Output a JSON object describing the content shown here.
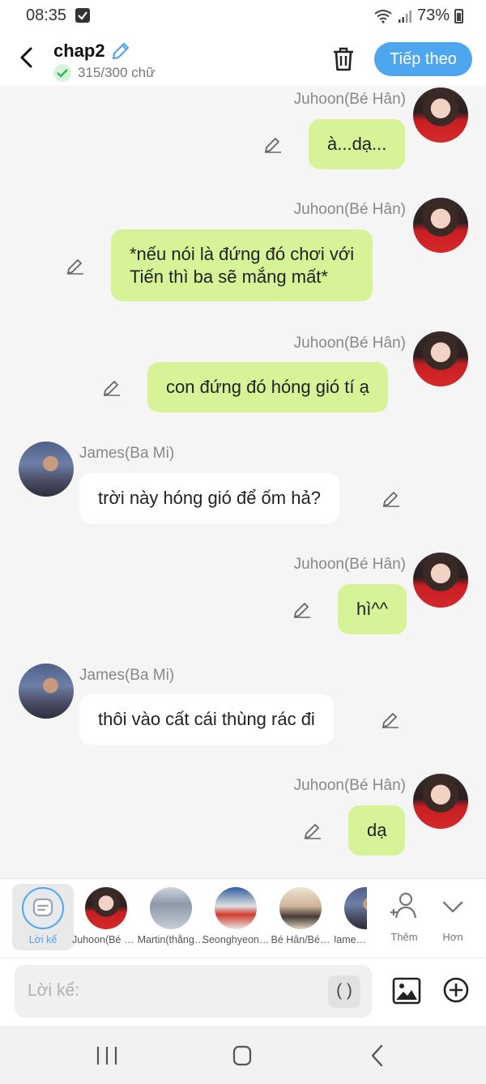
{
  "status_bar": {
    "time": "08:35",
    "battery": "73%"
  },
  "header": {
    "title": "chap2",
    "char_count": "315/300 chữ",
    "next_label": "Tiếp theo"
  },
  "messages": [
    {
      "sender": "Juhoon(Bé Hân)",
      "text": "à...dạ...",
      "side": "right"
    },
    {
      "sender": "Juhoon(Bé Hân)",
      "text_line1": "*nếu nói là đứng đó chơi với",
      "text_line2": "Tiến thì ba sẽ mắng mất*",
      "side": "right"
    },
    {
      "sender": "Juhoon(Bé Hân)",
      "text": "con đứng đó hóng gió tí ạ",
      "side": "right"
    },
    {
      "sender": "James(Ba Mi)",
      "text": "trời này hóng gió để ốm hả?",
      "side": "left"
    },
    {
      "sender": "Juhoon(Bé Hân)",
      "text": "hì^^",
      "side": "right"
    },
    {
      "sender": "James(Ba Mi)",
      "text": "thôi vào cất cái thùng rác đi",
      "side": "left"
    },
    {
      "sender": "Juhoon(Bé Hân)",
      "text": "dạ",
      "side": "right"
    }
  ],
  "characters": [
    {
      "label": "Lời kể",
      "active": true
    },
    {
      "label": "Juhoon(Bé Hân)"
    },
    {
      "label": "Martin(thằng…"
    },
    {
      "label": "Seonghyeon…"
    },
    {
      "label": "Bé Hân/Bé…"
    },
    {
      "label": "James(Ba Mi)"
    }
  ],
  "char_actions": {
    "add_label": "Thêm",
    "more_label": "Hơn"
  },
  "input": {
    "placeholder": "Lời kể:",
    "paren_label": "( )"
  },
  "colors": {
    "accent": "#4ea6ef",
    "right_bubble": "#d7f397",
    "left_bubble": "#ffffff"
  },
  "icons": [
    "back-icon",
    "pencil-icon",
    "check-icon",
    "trash-icon",
    "image-icon",
    "plus-circle-icon",
    "add-person-icon",
    "chevron-down-icon",
    "nav-recent-icon",
    "nav-home-icon",
    "nav-back-icon"
  ]
}
